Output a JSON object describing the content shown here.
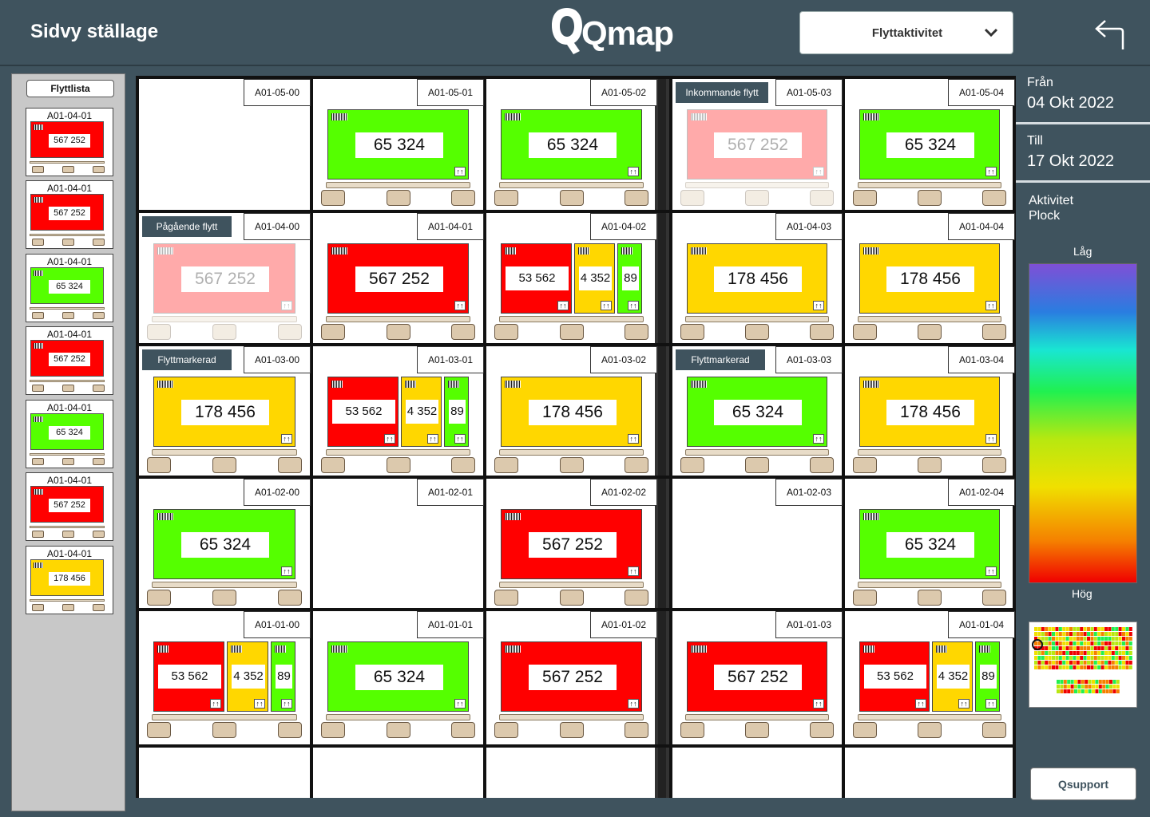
{
  "header": {
    "title": "Sidvy ställage",
    "logo": "Qmap",
    "dropdown_label": "Flyttaktivitet",
    "back_icon": "back-arrow-icon"
  },
  "sidebar": {
    "title": "Flyttlista",
    "cards": [
      {
        "location": "A01-04-01",
        "value": "567 252",
        "color": "red"
      },
      {
        "location": "A01-04-01",
        "value": "567 252",
        "color": "red"
      },
      {
        "location": "A01-04-01",
        "value": "65 324",
        "color": "green"
      },
      {
        "location": "A01-04-01",
        "value": "567 252",
        "color": "red"
      },
      {
        "location": "A01-04-01",
        "value": "65 324",
        "color": "green"
      },
      {
        "location": "A01-04-01",
        "value": "567 252",
        "color": "red"
      },
      {
        "location": "A01-04-01",
        "value": "178 456",
        "color": "yellow"
      }
    ]
  },
  "rack": {
    "rows": [
      {
        "cells": [
          {
            "location": "A01-05-00",
            "boxes": []
          },
          {
            "location": "A01-05-01",
            "boxes": [
              {
                "value": "65 324",
                "color": "green"
              }
            ]
          },
          {
            "location": "A01-05-02",
            "boxes": [
              {
                "value": "65 324",
                "color": "green"
              }
            ]
          },
          {
            "location": "A01-05-03",
            "tag": "Inkommande flytt",
            "faded": true,
            "boxes": [
              {
                "value": "567 252",
                "color": "red"
              }
            ]
          },
          {
            "location": "A01-05-04",
            "boxes": [
              {
                "value": "65 324",
                "color": "green"
              }
            ]
          }
        ]
      },
      {
        "cells": [
          {
            "location": "A01-04-00",
            "tag": "Pågående flytt",
            "faded": true,
            "boxes": [
              {
                "value": "567 252",
                "color": "red"
              }
            ]
          },
          {
            "location": "A01-04-01",
            "boxes": [
              {
                "value": "567 252",
                "color": "red"
              }
            ]
          },
          {
            "location": "A01-04-02",
            "boxes": [
              {
                "value": "53 562",
                "color": "red"
              },
              {
                "value": "4 352",
                "color": "yellow"
              },
              {
                "value": "89",
                "color": "green"
              }
            ]
          },
          {
            "location": "A01-04-03",
            "boxes": [
              {
                "value": "178 456",
                "color": "yellow"
              }
            ]
          },
          {
            "location": "A01-04-04",
            "boxes": [
              {
                "value": "178 456",
                "color": "yellow"
              }
            ]
          }
        ]
      },
      {
        "cells": [
          {
            "location": "A01-03-00",
            "tag": "Flyttmarkerad",
            "boxes": [
              {
                "value": "178 456",
                "color": "yellow"
              }
            ]
          },
          {
            "location": "A01-03-01",
            "boxes": [
              {
                "value": "53 562",
                "color": "red"
              },
              {
                "value": "4 352",
                "color": "yellow"
              },
              {
                "value": "89",
                "color": "green"
              }
            ]
          },
          {
            "location": "A01-03-02",
            "boxes": [
              {
                "value": "178 456",
                "color": "yellow"
              }
            ]
          },
          {
            "location": "A01-03-03",
            "tag": "Flyttmarkerad",
            "boxes": [
              {
                "value": "65 324",
                "color": "green"
              }
            ]
          },
          {
            "location": "A01-03-04",
            "boxes": [
              {
                "value": "178 456",
                "color": "yellow"
              }
            ]
          }
        ]
      },
      {
        "cells": [
          {
            "location": "A01-02-00",
            "boxes": [
              {
                "value": "65 324",
                "color": "green"
              }
            ]
          },
          {
            "location": "A01-02-01",
            "boxes": []
          },
          {
            "location": "A01-02-02",
            "boxes": [
              {
                "value": "567 252",
                "color": "red"
              }
            ]
          },
          {
            "location": "A01-02-03",
            "boxes": []
          },
          {
            "location": "A01-02-04",
            "boxes": [
              {
                "value": "65 324",
                "color": "green"
              }
            ]
          }
        ]
      },
      {
        "cells": [
          {
            "location": "A01-01-00",
            "boxes": [
              {
                "value": "53 562",
                "color": "red"
              },
              {
                "value": "4 352",
                "color": "yellow"
              },
              {
                "value": "89",
                "color": "green"
              }
            ]
          },
          {
            "location": "A01-01-01",
            "boxes": [
              {
                "value": "65 324",
                "color": "green"
              }
            ]
          },
          {
            "location": "A01-01-02",
            "boxes": [
              {
                "value": "567 252",
                "color": "red"
              }
            ]
          },
          {
            "location": "A01-01-03",
            "boxes": [
              {
                "value": "567 252",
                "color": "red"
              }
            ]
          },
          {
            "location": "A01-01-04",
            "boxes": [
              {
                "value": "53 562",
                "color": "red"
              },
              {
                "value": "4 352",
                "color": "yellow"
              },
              {
                "value": "89",
                "color": "green"
              }
            ]
          }
        ]
      }
    ]
  },
  "right_panel": {
    "from_label": "Från",
    "from_value": "04 Okt 2022",
    "to_label": "Till",
    "to_value": "17 Okt 2022",
    "activity_title": "Aktivitet",
    "activity_subtitle": "Plock",
    "low_label": "Låg",
    "high_label": "Hög",
    "support_button": "Qsupport"
  },
  "colors": {
    "red": "#ff0000",
    "yellow": "#ffd700",
    "green": "#55ff00",
    "brand": "#3f535e"
  }
}
